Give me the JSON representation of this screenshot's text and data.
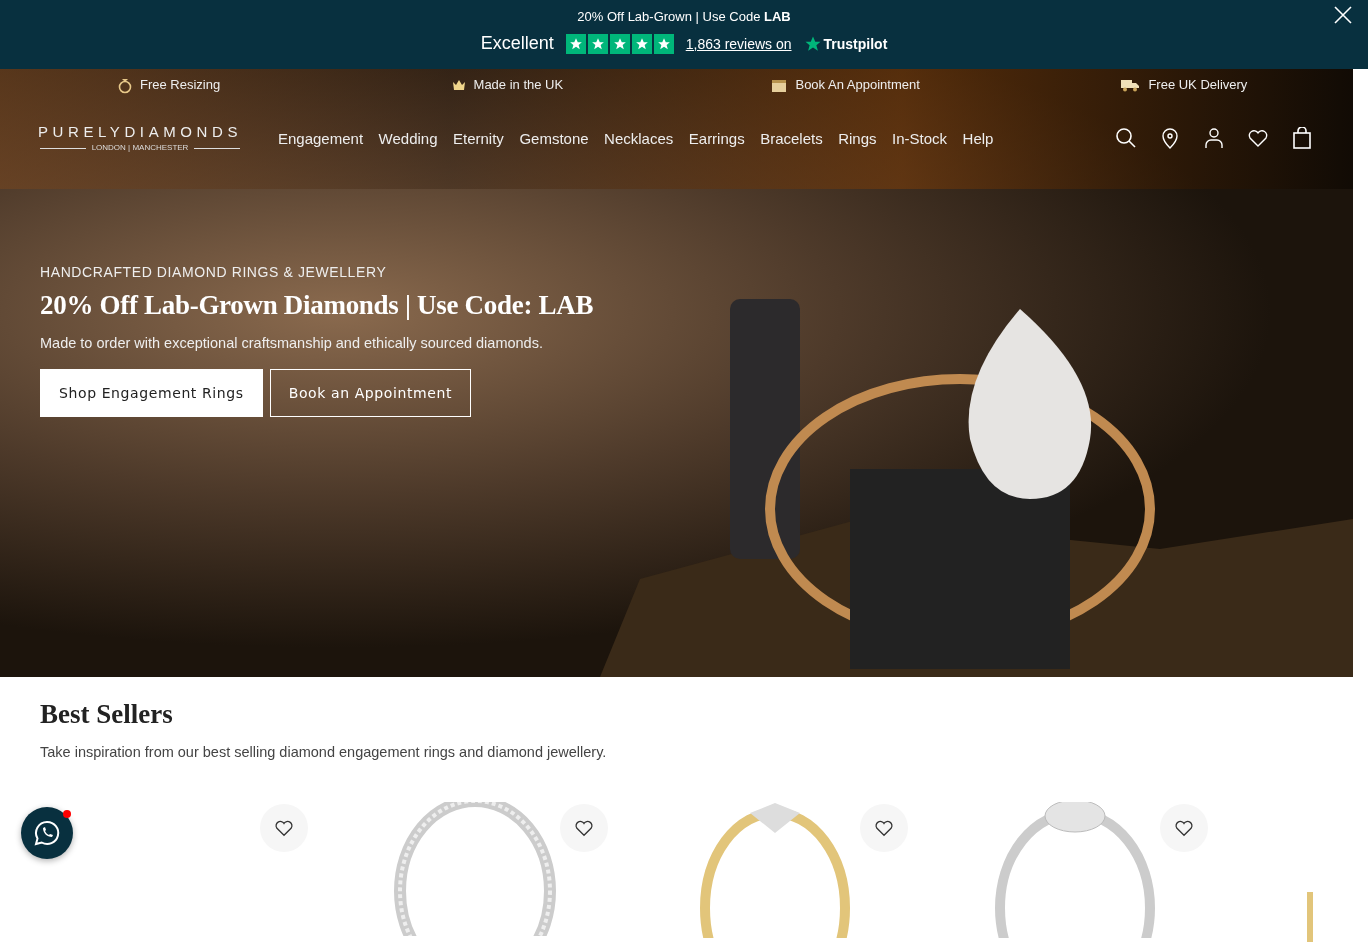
{
  "promo_bar": {
    "text": "20% Off Lab-Grown | Use Code **LAB**",
    "rating_label": "Excellent",
    "stars": 5,
    "reviews_link": "1,863 reviews on",
    "review_brand": "Trustpilot"
  },
  "usps": [
    {
      "kind": "ring",
      "label": "Free Resizing"
    },
    {
      "kind": "crown",
      "label": "Made in the UK"
    },
    {
      "kind": "calendar",
      "label": "Book An Appointment"
    },
    {
      "kind": "truck",
      "label": "Free UK Delivery"
    }
  ],
  "logo": {
    "name": "PURELYDIAMONDS",
    "tagline": "LONDON | MANCHESTER"
  },
  "nav": [
    "Engagement",
    "Wedding",
    "Eternity",
    "Gemstone",
    "Necklaces",
    "Earrings",
    "Bracelets",
    "Rings",
    "In-Stock",
    "Help"
  ],
  "hero": {
    "eyebrow": "HANDCRAFTED DIAMOND RINGS & JEWELLERY",
    "headline": "20% Off Lab-Grown Diamonds | Use Code: LAB",
    "subtext": "Made to order with exceptional craftsmanship and ethically sourced diamonds.",
    "buttons": [
      {
        "label": "Shop Engagement Rings",
        "kind": "solid"
      },
      {
        "label": "Book an Appointment",
        "kind": "outline"
      }
    ]
  },
  "best_sellers": {
    "title": "Best Sellers",
    "subtitle": "Take inspiration from our best selling diamond engagement rings and diamond jewellery.",
    "products": [
      {
        "kind": "none"
      },
      {
        "kind": "band"
      },
      {
        "kind": "solitaire"
      },
      {
        "kind": "halo"
      },
      {
        "kind": "partial"
      }
    ]
  },
  "chat": {
    "unread": true
  }
}
